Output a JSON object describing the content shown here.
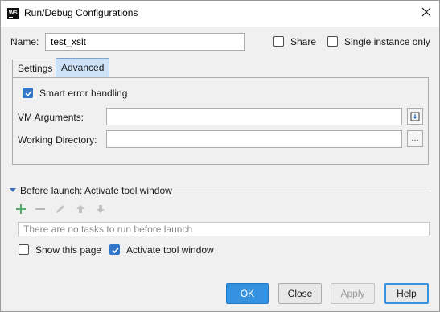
{
  "window": {
    "app_icon": "WS",
    "title": "Run/Debug Configurations"
  },
  "name_row": {
    "name_label": "Name:",
    "name_value": "test_xslt",
    "share_label": "Share",
    "share_checked": false,
    "single_instance_label": "Single instance only",
    "single_instance_checked": false
  },
  "tabs": [
    {
      "label": "Settings",
      "active": false
    },
    {
      "label": "Advanced",
      "active": true
    }
  ],
  "advanced": {
    "smart_error_label": "Smart error handling",
    "smart_error_checked": true,
    "vm_args_label": "VM Arguments:",
    "vm_args_value": "",
    "working_dir_label": "Working Directory:",
    "working_dir_value": "",
    "browse_label": "..."
  },
  "before_launch": {
    "title": "Before launch: Activate tool window",
    "toolbar_icons": [
      "add-icon",
      "remove-icon",
      "edit-icon",
      "move-up-icon",
      "move-down-icon"
    ],
    "empty_text": "There are no tasks to run before launch",
    "show_page_label": "Show this page",
    "show_page_checked": false,
    "activate_label": "Activate tool window",
    "activate_checked": true
  },
  "buttons": {
    "ok": "OK",
    "close": "Close",
    "apply": "Apply",
    "help": "Help"
  },
  "colors": {
    "accent": "#3592e0",
    "checkbox_checked": "#3375c9",
    "tab_active": "#cde2f7",
    "add_icon": "#59a869"
  }
}
